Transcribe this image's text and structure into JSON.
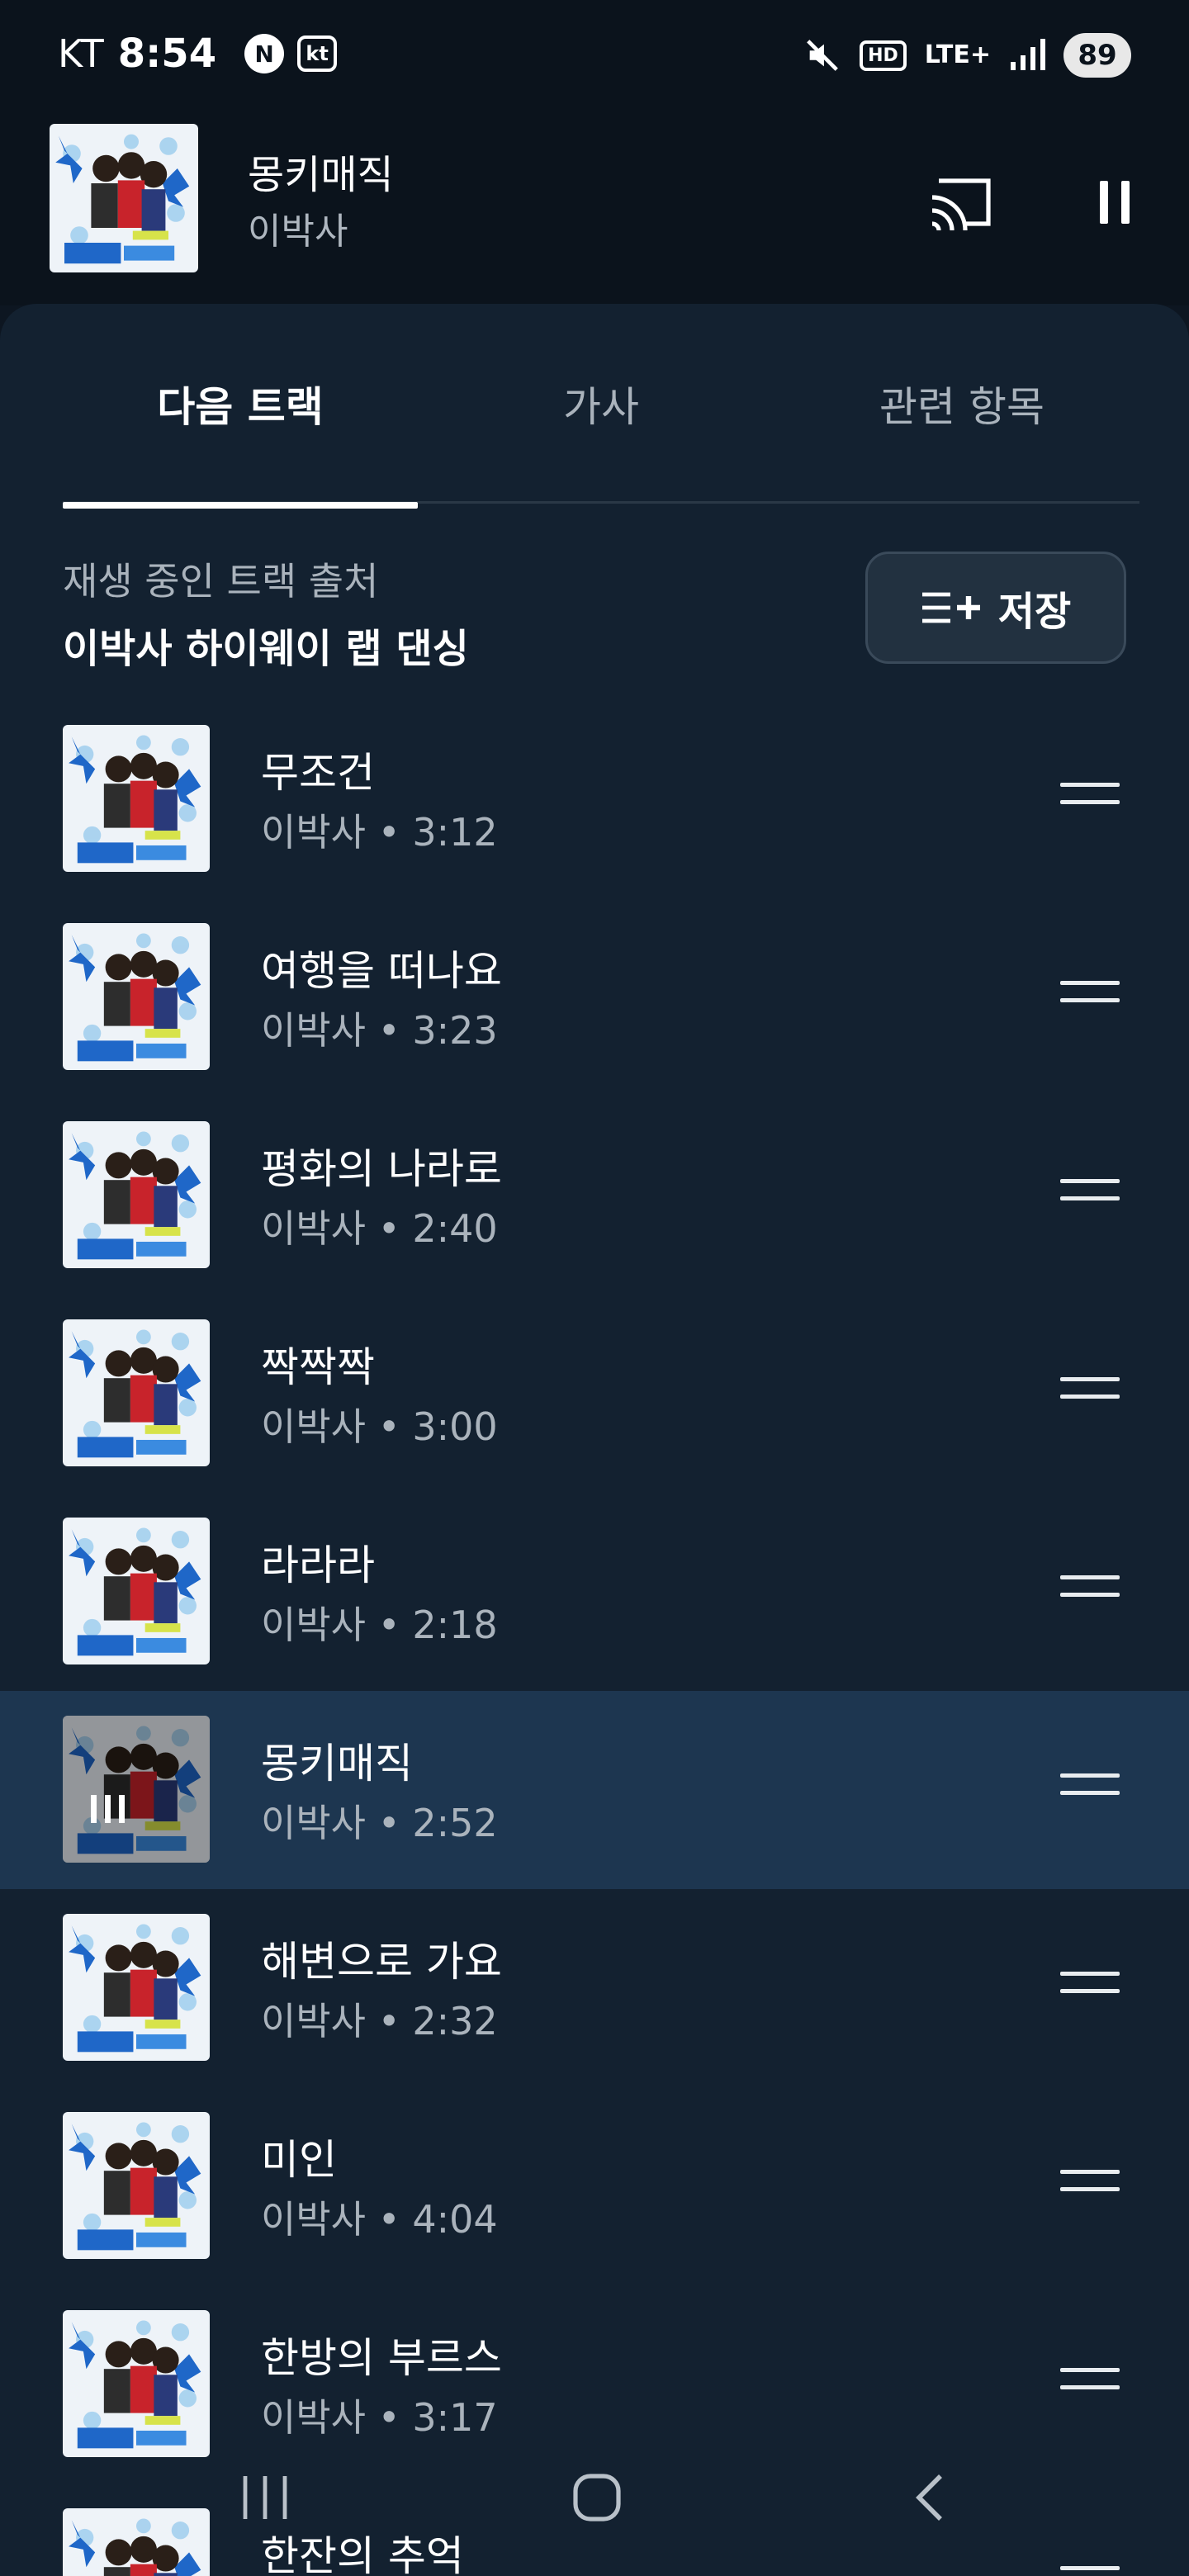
{
  "status_bar": {
    "carrier": "KT",
    "time": "8:54",
    "badge_n": "N",
    "badge_kt": "kt",
    "hd": "HD",
    "network": "LTE+",
    "battery": "89"
  },
  "mini_player": {
    "title": "몽키매직",
    "artist": "이박사"
  },
  "tabs": [
    {
      "label": "다음 트랙",
      "active": true
    },
    {
      "label": "가사",
      "active": false
    },
    {
      "label": "관련 항목",
      "active": false
    }
  ],
  "queue": {
    "source_label": "재생 중인 트랙 출처",
    "source_name": "이박사 하이웨이 랩 댄싱",
    "save_label": "저장"
  },
  "tracks": [
    {
      "title": "무조건",
      "meta": "이박사 • 3:12"
    },
    {
      "title": "여행을 떠나요",
      "meta": "이박사 • 3:23"
    },
    {
      "title": "평화의 나라로",
      "meta": "이박사 • 2:40"
    },
    {
      "title": "짝짝짝",
      "meta": "이박사 • 3:00"
    },
    {
      "title": "라라라",
      "meta": "이박사 • 2:18"
    },
    {
      "title": "몽키매직",
      "meta": "이박사 • 2:52",
      "playing": true
    },
    {
      "title": "해변으로 가요",
      "meta": "이박사 • 2:32"
    },
    {
      "title": "미인",
      "meta": "이박사 • 4:04"
    },
    {
      "title": "한방의 부르스",
      "meta": "이박사 • 3:17"
    },
    {
      "title": "한잔의 추억",
      "meta": ""
    }
  ],
  "icons": {
    "cast": "cast-icon",
    "pause": "pause-icon",
    "playlist_add": "playlist-add-icon",
    "drag": "drag-handle-icon",
    "nav_recents": "recents-icon",
    "nav_home": "home-icon",
    "nav_back": "back-icon"
  },
  "colors": {
    "background": "#0b131c",
    "sheet": "#132130",
    "playing_row": "#1d3650",
    "secondary_text": "#aab3bc"
  }
}
